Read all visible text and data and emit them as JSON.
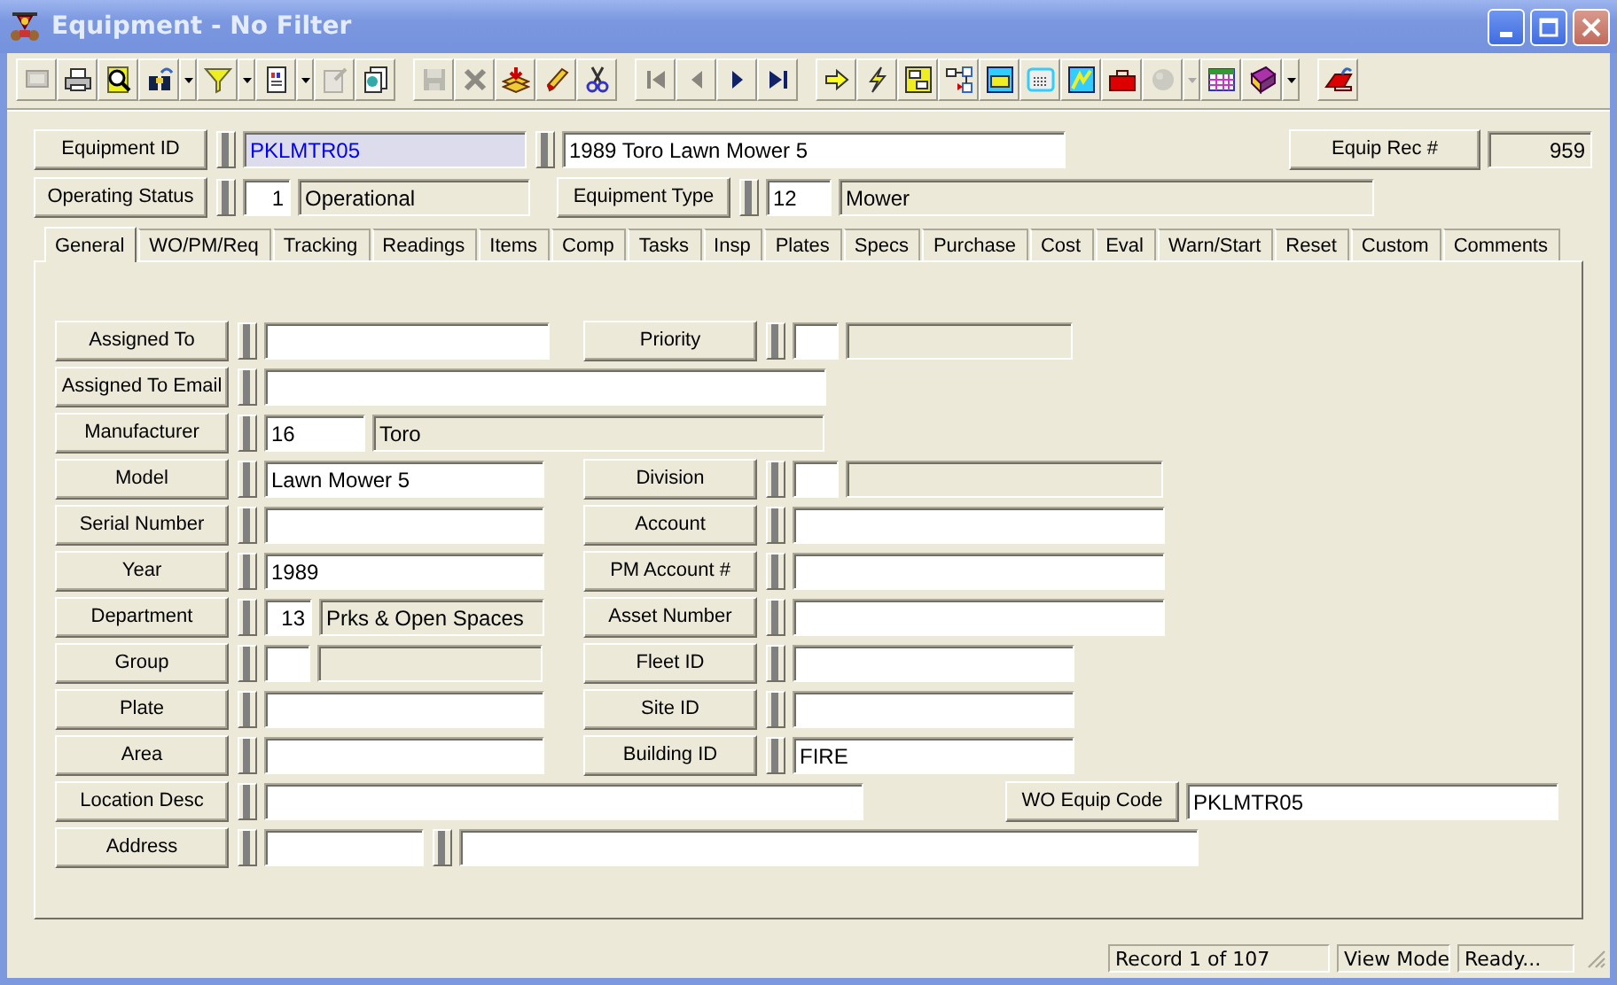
{
  "window": {
    "title": "Equipment - No Filter"
  },
  "toolbar": [
    [
      {
        "kind": "button",
        "disabled": true
      },
      {
        "kind": "button",
        "disabled": false
      },
      {
        "kind": "button",
        "disabled": false
      },
      {
        "kind": "button",
        "disabled": false
      },
      {
        "kind": "dropdown",
        "disabled": false
      },
      {
        "kind": "button",
        "disabled": false
      },
      {
        "kind": "dropdown",
        "disabled": false
      },
      {
        "kind": "button",
        "disabled": false
      },
      {
        "kind": "dropdown",
        "disabled": false
      },
      {
        "kind": "button",
        "disabled": true
      },
      {
        "kind": "button",
        "disabled": false
      }
    ],
    [
      {
        "kind": "button",
        "disabled": true
      },
      {
        "kind": "button",
        "disabled": true
      },
      {
        "kind": "button",
        "disabled": false
      },
      {
        "kind": "button",
        "disabled": false
      },
      {
        "kind": "button",
        "disabled": false
      }
    ],
    [
      {
        "kind": "button",
        "disabled": true
      },
      {
        "kind": "button",
        "disabled": true
      },
      {
        "kind": "button",
        "disabled": false
      },
      {
        "kind": "button",
        "disabled": false
      }
    ],
    [
      {
        "kind": "button",
        "disabled": false
      },
      {
        "kind": "button",
        "disabled": false
      },
      {
        "kind": "button",
        "disabled": false
      },
      {
        "kind": "button",
        "disabled": false
      },
      {
        "kind": "button",
        "disabled": false
      },
      {
        "kind": "button",
        "disabled": false
      },
      {
        "kind": "button",
        "disabled": false
      },
      {
        "kind": "button",
        "disabled": false
      },
      {
        "kind": "button",
        "disabled": true
      },
      {
        "kind": "dropdown",
        "disabled": true
      },
      {
        "kind": "button",
        "disabled": false
      },
      {
        "kind": "button",
        "disabled": false
      },
      {
        "kind": "dropdown",
        "disabled": false
      }
    ],
    [
      {
        "kind": "button",
        "disabled": false
      }
    ]
  ],
  "header": {
    "equipment_id": {
      "label": "Equipment ID",
      "value": "PKLMTR05",
      "description": "1989 Toro Lawn Mower 5"
    },
    "equip_rec": {
      "label": "Equip Rec #",
      "value": "959"
    },
    "operating_status": {
      "label": "Operating Status",
      "code": "1",
      "description": "Operational"
    },
    "equipment_type": {
      "label": "Equipment Type",
      "code": "12",
      "description": "Mower"
    }
  },
  "tabs": [
    {
      "label": "General",
      "selected": true
    },
    {
      "label": "WO/PM/Req",
      "selected": false
    },
    {
      "label": "Tracking",
      "selected": false
    },
    {
      "label": "Readings",
      "selected": false
    },
    {
      "label": "Items",
      "selected": false
    },
    {
      "label": "Comp",
      "selected": false
    },
    {
      "label": "Tasks",
      "selected": false
    },
    {
      "label": "Insp",
      "selected": false
    },
    {
      "label": "Plates",
      "selected": false
    },
    {
      "label": "Specs",
      "selected": false
    },
    {
      "label": "Purchase",
      "selected": false
    },
    {
      "label": "Cost",
      "selected": false
    },
    {
      "label": "Eval",
      "selected": false
    },
    {
      "label": "Warn/Start",
      "selected": false
    },
    {
      "label": "Reset",
      "selected": false
    },
    {
      "label": "Custom",
      "selected": false
    },
    {
      "label": "Comments",
      "selected": false
    }
  ],
  "rows": [
    {
      "left": {
        "label": "Assigned To",
        "lookup": true,
        "fields": [
          {
            "kind": "input"
          }
        ]
      },
      "right": {
        "label": "Priority",
        "lookup": true,
        "fields": [
          {
            "kind": "input"
          },
          {
            "kind": "readonly"
          }
        ]
      }
    },
    {
      "left": {
        "label": "Assigned To Email",
        "lookup": true,
        "fields": [
          {
            "kind": "input"
          }
        ]
      }
    },
    {
      "left": {
        "label": "Manufacturer",
        "lookup": true,
        "fields": [
          {
            "kind": "input",
            "value": "16"
          },
          {
            "kind": "readonly",
            "value": "Toro"
          }
        ]
      }
    },
    {
      "left": {
        "label": "Model",
        "lookup": true,
        "fields": [
          {
            "kind": "input",
            "value": "Lawn Mower 5"
          }
        ]
      },
      "right": {
        "label": "Division",
        "lookup": true,
        "fields": [
          {
            "kind": "input"
          },
          {
            "kind": "readonly"
          }
        ]
      }
    },
    {
      "left": {
        "label": "Serial Number",
        "lookup": true,
        "fields": [
          {
            "kind": "input"
          }
        ]
      },
      "right": {
        "label": "Account",
        "lookup": true,
        "fields": [
          {
            "kind": "input"
          }
        ]
      }
    },
    {
      "left": {
        "label": "Year",
        "lookup": true,
        "fields": [
          {
            "kind": "input",
            "value": "1989"
          }
        ]
      },
      "right": {
        "label": "PM Account #",
        "lookup": true,
        "fields": [
          {
            "kind": "input"
          }
        ]
      }
    },
    {
      "left": {
        "label": "Department",
        "lookup": true,
        "fields": [
          {
            "kind": "code",
            "value": "13"
          },
          {
            "kind": "readonly",
            "value": "Prks & Open Spaces"
          }
        ]
      },
      "right": {
        "label": "Asset Number",
        "lookup": true,
        "fields": [
          {
            "kind": "input"
          }
        ]
      }
    },
    {
      "left": {
        "label": "Group",
        "lookup": true,
        "fields": [
          {
            "kind": "input"
          },
          {
            "kind": "readonly"
          }
        ]
      },
      "right": {
        "label": "Fleet ID",
        "lookup": true,
        "fields": [
          {
            "kind": "input"
          }
        ]
      }
    },
    {
      "left": {
        "label": "Plate",
        "lookup": true,
        "fields": [
          {
            "kind": "input"
          }
        ]
      },
      "right": {
        "label": "Site ID",
        "lookup": true,
        "fields": [
          {
            "kind": "input"
          }
        ]
      }
    },
    {
      "left": {
        "label": "Area",
        "lookup": true,
        "fields": [
          {
            "kind": "input"
          }
        ]
      },
      "right": {
        "label": "Building ID",
        "lookup": true,
        "fields": [
          {
            "kind": "input",
            "value": "FIRE"
          }
        ]
      }
    },
    {
      "left": {
        "label": "Location Desc",
        "lookup": true,
        "fields": [
          {
            "kind": "input"
          }
        ]
      },
      "right": {
        "label": "WO Equip Code",
        "lookup": false,
        "fields": [
          {
            "kind": "input",
            "value": "PKLMTR05"
          }
        ]
      }
    },
    {
      "left": {
        "label": "Address",
        "lookup": true,
        "fields": [
          {
            "kind": "input"
          },
          {
            "kind": "grip"
          },
          {
            "kind": "input"
          }
        ]
      }
    }
  ],
  "status_bar": {
    "panes": [
      "Record 1 of 107",
      "View Mode",
      "Ready..."
    ]
  }
}
